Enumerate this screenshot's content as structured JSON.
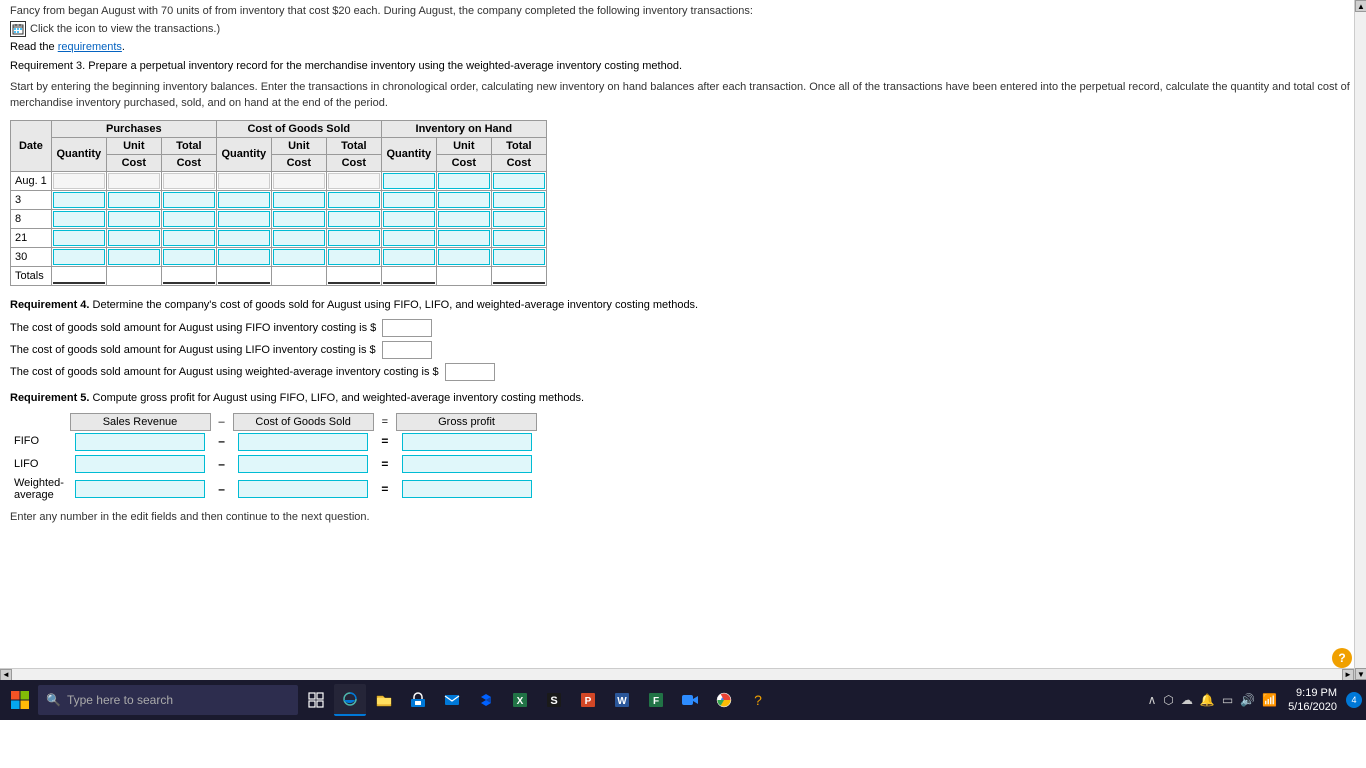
{
  "header": {
    "click_text": "Click the icon to view the transactions.)",
    "read_req": "Read the",
    "req_link": "requirements",
    "truncated_text": "Fancy from began August with 70 units of from inventory that cost $20 each. During August, the company completed the following inventory transactions:"
  },
  "req3": {
    "heading_bold": "Requirement 3.",
    "heading_text": "Prepare a perpetual inventory record for the merchandise inventory using the weighted-average inventory costing method.",
    "instruction": "Start by entering the beginning inventory balances. Enter the transactions in chronological order, calculating new inventory on hand balances after each transaction. Once all of the transactions have been entered into the perpetual record, calculate the quantity and total cost of merchandise inventory purchased, sold, and on hand at the end of the period."
  },
  "inventory_table": {
    "col_groups": [
      "Purchases",
      "Cost of Goods Sold",
      "Inventory on Hand"
    ],
    "col_headers": [
      "Date",
      "Quantity",
      "Unit Cost",
      "Total Cost",
      "Quantity",
      "Unit Cost",
      "Total Cost",
      "Quantity",
      "Unit Cost",
      "Total Cost"
    ],
    "rows": [
      {
        "date": "Aug. 1"
      },
      {
        "date": "3"
      },
      {
        "date": "8"
      },
      {
        "date": "21"
      },
      {
        "date": "30"
      },
      {
        "date": "Totals"
      }
    ]
  },
  "req4": {
    "heading_bold": "Requirement 4.",
    "heading_text": "Determine the company's cost of goods sold for August using FIFO, LIFO, and weighted-average inventory costing methods.",
    "lines": [
      "The cost of goods sold amount for August using FIFO inventory costing is $",
      "The cost of goods sold amount for August using LIFO inventory costing is $",
      "The cost of goods sold amount for August using weighted-average inventory costing is $"
    ]
  },
  "req5": {
    "heading_bold": "Requirement 5.",
    "heading_text": "Compute gross profit for August using FIFO, LIFO, and weighted-average inventory costing methods.",
    "col_headers": [
      "Sales Revenue",
      "–",
      "Cost of Goods Sold",
      "=",
      "Gross profit"
    ],
    "rows": [
      "FIFO",
      "LIFO",
      "Weighted-average"
    ]
  },
  "footer": {
    "enter_note": "Enter any number in the edit fields and then continue to the next question."
  },
  "taskbar": {
    "search_placeholder": "Type here to search",
    "time": "9:19 PM",
    "date": "5/16/2020",
    "notification_count": "4"
  }
}
